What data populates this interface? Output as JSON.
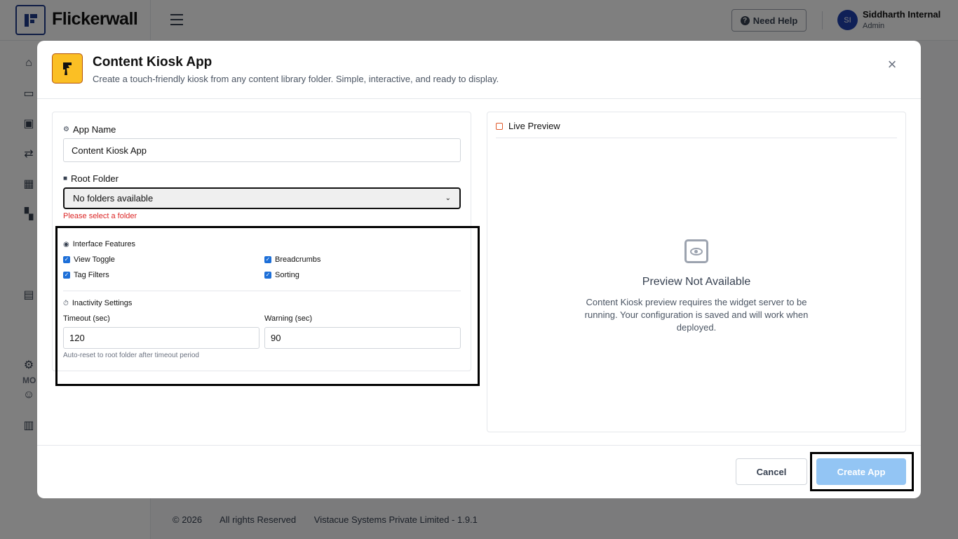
{
  "app": {
    "logo_text": "Flickerwall",
    "help_label": "Need Help",
    "user": {
      "initials": "SI",
      "name": "Siddharth Internal",
      "role": "Admin"
    },
    "sidebar_section_label": "MO",
    "footer": {
      "copyright": "© 2026",
      "rights": "All rights Reserved",
      "company": "Vistacue Systems Private Limited - 1.9.1"
    }
  },
  "modal": {
    "title": "Content Kiosk App",
    "subtitle": "Create a touch-friendly kiosk from any content library folder. Simple, interactive, and ready to display.",
    "close_glyph": "×",
    "app_name": {
      "label": "App Name",
      "value": "Content Kiosk App"
    },
    "root_folder": {
      "label": "Root Folder",
      "selected": "No folders available",
      "error": "Please select a folder"
    },
    "interface_features": {
      "label": "Interface Features",
      "view_toggle": "View Toggle",
      "breadcrumbs": "Breadcrumbs",
      "tag_filters": "Tag Filters",
      "sorting": "Sorting"
    },
    "inactivity": {
      "label": "Inactivity Settings",
      "timeout_label": "Timeout (sec)",
      "timeout_value": "120",
      "warning_label": "Warning (sec)",
      "warning_value": "90",
      "hint": "Auto-reset to root folder after timeout period"
    },
    "preview": {
      "heading": "Live Preview",
      "title": "Preview Not Available",
      "description": "Content Kiosk preview requires the widget server to be running. Your configuration is saved and will work when deployed."
    },
    "buttons": {
      "cancel": "Cancel",
      "create": "Create App"
    }
  },
  "colors": {
    "accent": "#1d6fd8",
    "create_disabled": "#93c5f4",
    "error": "#dc2626",
    "icon_bg": "#fbbf24"
  }
}
